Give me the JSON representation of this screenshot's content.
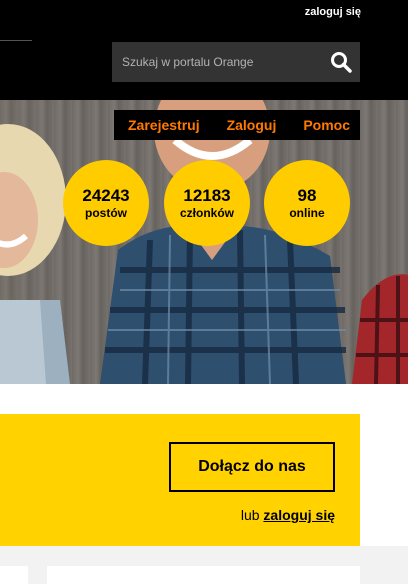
{
  "header": {
    "top_login": "zaloguj się",
    "search": {
      "placeholder": "Szukaj w portalu Orange"
    }
  },
  "auth": {
    "register": "Zarejestruj",
    "login": "Zaloguj",
    "help": "Pomoc"
  },
  "stats": [
    {
      "value": "24243",
      "label": "postów"
    },
    {
      "value": "12183",
      "label": "członków"
    },
    {
      "value": "98",
      "label": "online"
    }
  ],
  "join": {
    "button": "Dołącz do nas",
    "or_text": "lub",
    "login_link": "zaloguj się"
  },
  "colors": {
    "accent_yellow": "#ffd200",
    "circle_yellow": "#ffcc00",
    "link_orange": "#ff7900",
    "header_bg": "#000000",
    "search_bg": "#333333"
  }
}
